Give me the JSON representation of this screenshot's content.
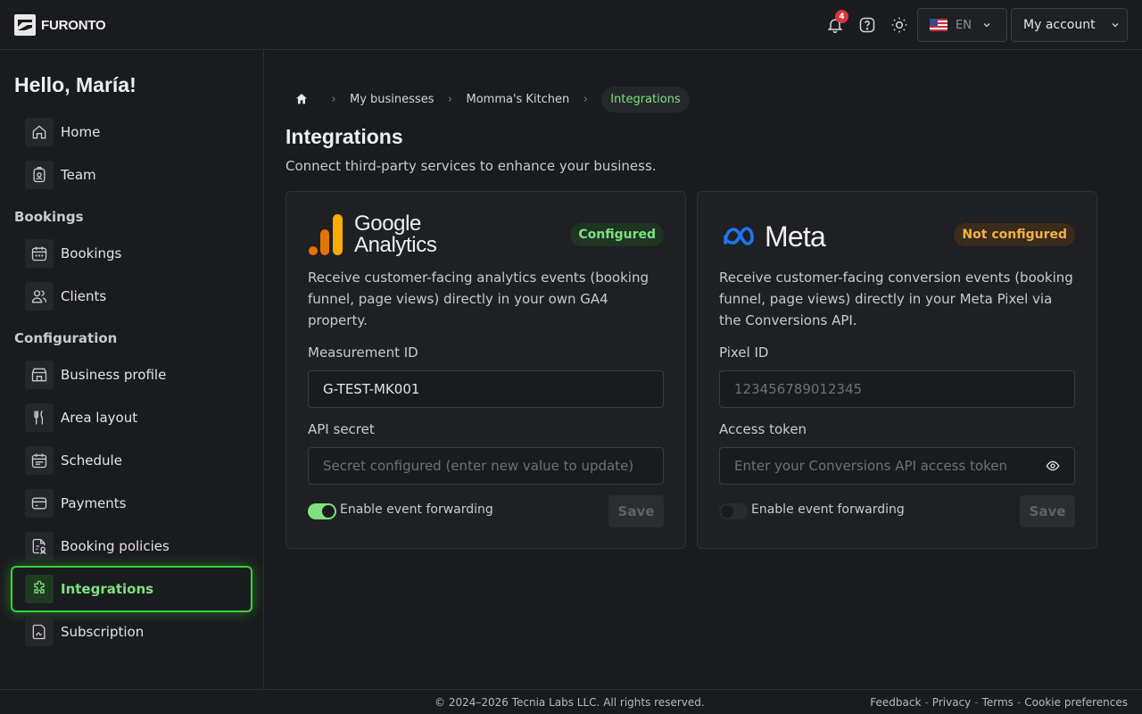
{
  "header": {
    "brand": "FURONTO",
    "notifications_count": "4",
    "language": "EN",
    "account_label": "My account"
  },
  "sidebar": {
    "greeting": "Hello, María!",
    "top_items": [
      {
        "label": "Home",
        "icon": "home-icon"
      },
      {
        "label": "Team",
        "icon": "badge-icon"
      }
    ],
    "sections": [
      {
        "title": "Bookings",
        "items": [
          {
            "label": "Bookings",
            "icon": "calendar-icon"
          },
          {
            "label": "Clients",
            "icon": "users-icon"
          }
        ]
      },
      {
        "title": "Configuration",
        "items": [
          {
            "label": "Business profile",
            "icon": "storefront-icon"
          },
          {
            "label": "Area layout",
            "icon": "utensils-icon"
          },
          {
            "label": "Schedule",
            "icon": "schedule-icon"
          },
          {
            "label": "Payments",
            "icon": "credit-card-icon"
          },
          {
            "label": "Booking policies",
            "icon": "policy-icon"
          },
          {
            "label": "Integrations",
            "icon": "puzzle-icon",
            "active": true
          },
          {
            "label": "Subscription",
            "icon": "contract-icon"
          }
        ]
      }
    ]
  },
  "breadcrumb": {
    "items": [
      "My businesses",
      "Momma's Kitchen"
    ],
    "current": "Integrations"
  },
  "page": {
    "title": "Integrations",
    "subtitle": "Connect third-party services to enhance your business."
  },
  "cards": {
    "google": {
      "logo_line1": "Google",
      "logo_line2": "Analytics",
      "status": "Configured",
      "status_color": "#7ee07e",
      "description": "Receive customer-facing analytics events (booking funnel, page views) directly in your own GA4 property.",
      "field1_label": "Measurement ID",
      "field1_value": "G-TEST-MK001",
      "field2_label": "API secret",
      "field2_placeholder": "Secret configured (enter new value to update)",
      "toggle_label": "Enable event forwarding",
      "toggle_on": true,
      "save_label": "Save"
    },
    "meta": {
      "logo_text": "Meta",
      "status": "Not configured",
      "status_color": "#f0b04a",
      "description": "Receive customer-facing conversion events (booking funnel, page views) directly in your Meta Pixel via the Conversions API.",
      "field1_label": "Pixel ID",
      "field1_placeholder": "123456789012345",
      "field2_label": "Access token",
      "field2_placeholder": "Enter your Conversions API access token",
      "toggle_label": "Enable event forwarding",
      "toggle_on": false,
      "save_label": "Save"
    }
  },
  "footer": {
    "copyright": "© 2024–2026 Tecnia Labs LLC. All rights reserved.",
    "links": [
      "Feedback",
      "Privacy",
      "Terms",
      "Cookie preferences"
    ]
  }
}
